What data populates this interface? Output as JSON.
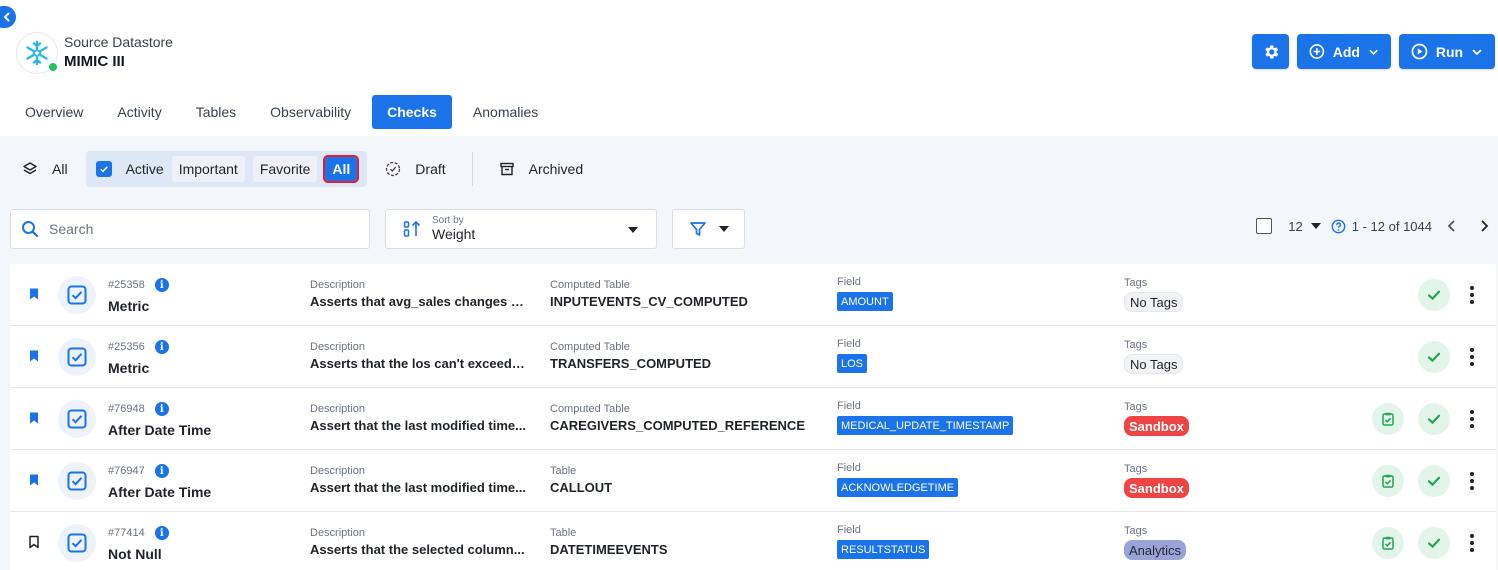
{
  "datastore": {
    "subtitle": "Source Datastore",
    "name": "MIMIC III"
  },
  "actions": {
    "add_label": "Add",
    "run_label": "Run"
  },
  "tabs": [
    {
      "label": "Overview"
    },
    {
      "label": "Activity"
    },
    {
      "label": "Tables"
    },
    {
      "label": "Observability"
    },
    {
      "label": "Checks",
      "active": true
    },
    {
      "label": "Anomalies"
    }
  ],
  "status_filters": {
    "all": "All",
    "active": "Active",
    "important": "Important",
    "favorite": "Favorite",
    "active_all": "All",
    "draft": "Draft",
    "archived": "Archived"
  },
  "search": {
    "placeholder": "Search"
  },
  "sort": {
    "label": "Sort by",
    "value": "Weight"
  },
  "pagination": {
    "page_size": "12",
    "range": "1 - 12 of 1044"
  },
  "columns": {
    "description": "Description",
    "field": "Field",
    "tags": "Tags"
  },
  "checks": [
    {
      "id": "#25358",
      "name": "Metric",
      "description": "Asserts that avg_sales changes b...",
      "table_type": "Computed Table",
      "table": "INPUTEVENTS_CV_COMPUTED",
      "field": "AMOUNT",
      "tag": "No Tags",
      "tag_style": "none",
      "bookmarked": true,
      "sandbox_icon": false
    },
    {
      "id": "#25356",
      "name": "Metric",
      "description": "Asserts that the los can't exceed t...",
      "table_type": "Computed Table",
      "table": "TRANSFERS_COMPUTED",
      "field": "LOS",
      "tag": "No Tags",
      "tag_style": "none",
      "bookmarked": true,
      "sandbox_icon": false
    },
    {
      "id": "#76948",
      "name": "After Date Time",
      "description": "Assert that the last modified time...",
      "table_type": "Computed Table",
      "table": "CAREGIVERS_COMPUTED_REFERENCE",
      "field": "MEDICAL_UPDATE_TIMESTAMP",
      "tag": "Sandbox",
      "tag_style": "red",
      "bookmarked": true,
      "sandbox_icon": true
    },
    {
      "id": "#76947",
      "name": "After Date Time",
      "description": "Assert that the last modified time...",
      "table_type": "Table",
      "table": "CALLOUT",
      "field": "ACKNOWLEDGETIME",
      "tag": "Sandbox",
      "tag_style": "red",
      "bookmarked": true,
      "sandbox_icon": true
    },
    {
      "id": "#77414",
      "name": "Not Null",
      "description": "Asserts that the selected column...",
      "table_type": "Table",
      "table": "DATETIMEEVENTS",
      "field": "RESULTSTATUS",
      "tag": "Analytics",
      "tag_style": "purple",
      "bookmarked": false,
      "sandbox_icon": true
    }
  ],
  "colors": {
    "accent": "#1a73e8",
    "success": "#22c55e",
    "sandbox_tag": "#ef4444",
    "analytics_tag": "#9aa3d6"
  }
}
